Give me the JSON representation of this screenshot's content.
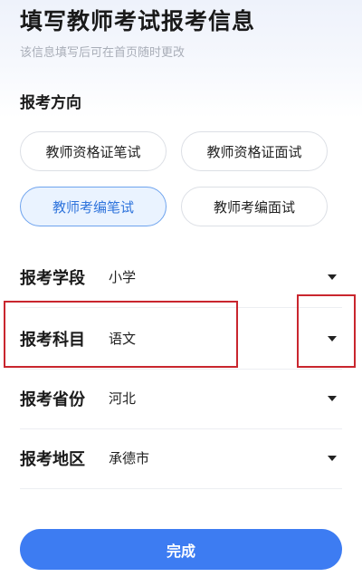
{
  "header": {
    "title": "填写教师考试报考信息",
    "subtitle": "该信息填写后可在首页随时更改"
  },
  "direction": {
    "label": "报考方向",
    "options": [
      {
        "label": "教师资格证笔试",
        "selected": false
      },
      {
        "label": "教师资格证面试",
        "selected": false
      },
      {
        "label": "教师考编笔试",
        "selected": true
      },
      {
        "label": "教师考编面试",
        "selected": false
      }
    ]
  },
  "fields": [
    {
      "label": "报考学段",
      "value": "小学",
      "icon": "caret-down-icon"
    },
    {
      "label": "报考科目",
      "value": "语文",
      "icon": "caret-down-icon"
    },
    {
      "label": "报考省份",
      "value": "河北",
      "icon": "caret-down-icon"
    },
    {
      "label": "报考地区",
      "value": "承德市",
      "icon": "caret-down-icon"
    }
  ],
  "submit": {
    "label": "完成"
  },
  "colors": {
    "accent": "#3d7cf2",
    "selected_chip_bg": "#eaf3ff",
    "selected_chip_text": "#2f74dc",
    "highlight_box": "#c9262e"
  }
}
